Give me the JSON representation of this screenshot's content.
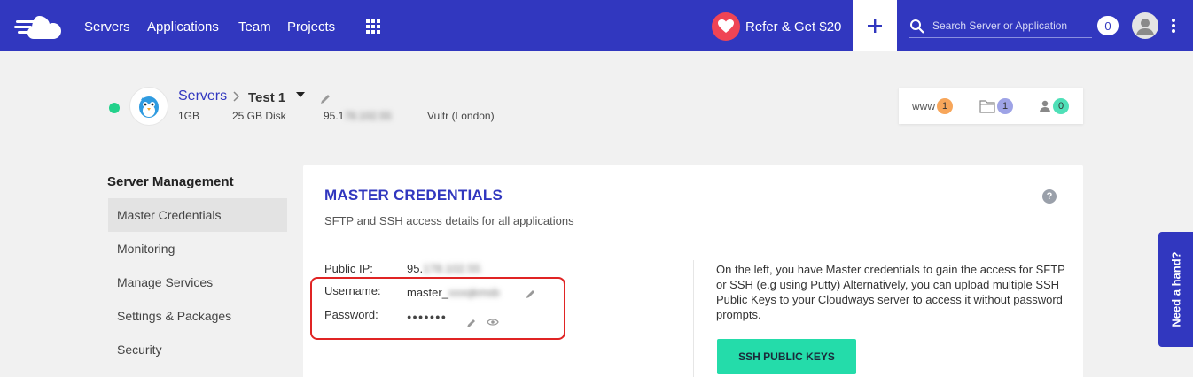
{
  "topbar": {
    "nav": [
      "Servers",
      "Applications",
      "Team",
      "Projects"
    ],
    "refer_label": "Refer & Get $20",
    "search_placeholder": "Search Server or Application",
    "notifications": "0"
  },
  "server": {
    "breadcrumb_root": "Servers",
    "name": "Test 1",
    "ram": "1GB",
    "disk": "25 GB Disk",
    "ip_visible": "95.1",
    "ip_blurred": "78.102.55",
    "provider": "Vultr (London)",
    "status_color": "#23d18b"
  },
  "stats": {
    "www_label": "www",
    "www_count": "1",
    "files_count": "1",
    "users_count": "0"
  },
  "sidebar": {
    "title": "Server Management",
    "items": [
      "Master Credentials",
      "Monitoring",
      "Manage Services",
      "Settings & Packages",
      "Security"
    ],
    "active_index": 0
  },
  "card": {
    "title": "MASTER CREDENTIALS",
    "subtitle": "SFTP and SSH access details for all applications",
    "help": "?",
    "public_ip_label": "Public IP:",
    "public_ip_visible": "95.",
    "public_ip_blurred": "178.102.55",
    "username_label": "Username:",
    "username_visible": "master_",
    "username_blurred": "xxxqkmsb",
    "password_label": "Password:",
    "password_mask": "●●●●●●●",
    "info_text": "On the left, you have Master credentials to gain the access for SFTP or SSH (e.g using Putty) Alternatively, you can upload multiple SSH Public Keys to your Cloudways server to access it without password prompts.",
    "ssh_button": "SSH PUBLIC KEYS"
  },
  "help_tab": "Need a hand?",
  "colors": {
    "brand": "#3137bf",
    "accent_green": "#24dcaa",
    "highlight": "#e02424"
  }
}
